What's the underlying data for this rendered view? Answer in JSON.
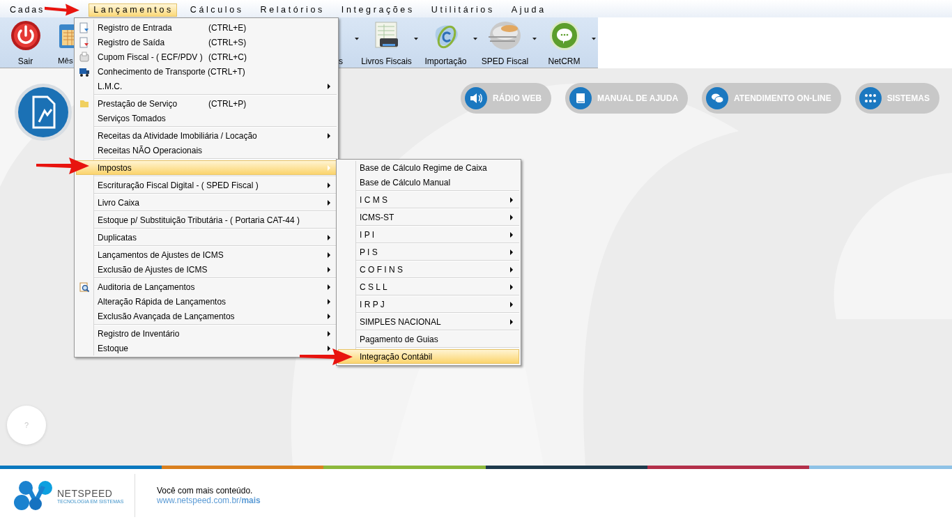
{
  "menu_bar": [
    {
      "label": "Cadas",
      "selected": false
    },
    {
      "label": "Lançamentos",
      "selected": true
    },
    {
      "label": "Cálculos",
      "selected": false
    },
    {
      "label": "Relatórios",
      "selected": false
    },
    {
      "label": "Integrações",
      "selected": false
    },
    {
      "label": "Utilitários",
      "selected": false
    },
    {
      "label": "Ajuda",
      "selected": false
    }
  ],
  "toolbar": [
    {
      "label": "Sair",
      "kind": "full",
      "dropdown": false
    },
    {
      "label": "Mês",
      "kind": "cut_right",
      "dropdown": false
    },
    {
      "label": "s",
      "kind": "cut_left",
      "dropdown": true
    },
    {
      "label": "Livros Fiscais",
      "kind": "full",
      "dropdown": true
    },
    {
      "label": "Importação",
      "kind": "full",
      "dropdown": true
    },
    {
      "label": "SPED Fiscal",
      "kind": "full",
      "dropdown": true
    },
    {
      "label": "NetCRM",
      "kind": "full",
      "dropdown": true
    }
  ],
  "quick_buttons": [
    {
      "label": "RÁDIO WEB"
    },
    {
      "label": "MANUAL DE AJUDA"
    },
    {
      "label": "ATENDIMENTO ON-LINE"
    },
    {
      "label": "SISTEMAS"
    }
  ],
  "help_button": {
    "label": "?"
  },
  "menu": {
    "groups": [
      [
        {
          "label": "Registro de Entrada",
          "shortcut": "(CTRL+E)",
          "submenu": false,
          "selected": false
        },
        {
          "label": "Registro de Saída",
          "shortcut": "(CTRL+S)",
          "submenu": false,
          "selected": false
        },
        {
          "label": "Cupom Fiscal - ( ECF/PDV )",
          "shortcut": "(CTRL+C)",
          "submenu": false,
          "selected": false
        },
        {
          "label": "Conhecimento de Transporte (CTRL+T)",
          "submenu": false,
          "selected": false
        },
        {
          "label": "L.M.C.",
          "submenu": true,
          "selected": false
        }
      ],
      [
        {
          "label": "Prestação de Serviço",
          "shortcut": "(CTRL+P)",
          "submenu": false,
          "selected": false
        },
        {
          "label": "Serviços Tomados",
          "submenu": false,
          "selected": false
        }
      ],
      [
        {
          "label": "Receitas da Atividade Imobiliária / Locação",
          "submenu": true,
          "selected": false
        },
        {
          "label": "Receitas NÃO Operacionais",
          "submenu": false,
          "selected": false
        }
      ],
      [
        {
          "label": "Impostos",
          "submenu": true,
          "selected": true
        }
      ],
      [
        {
          "label": "Escrituração Fiscal Digital - ( SPED Fiscal )",
          "submenu": true,
          "selected": false
        }
      ],
      [
        {
          "label": "Livro Caixa",
          "submenu": true,
          "selected": false
        }
      ],
      [
        {
          "label": "Estoque p/ Substituição Tributária - ( Portaria CAT-44 )",
          "submenu": false,
          "selected": false
        }
      ],
      [
        {
          "label": "Duplicatas",
          "submenu": true,
          "selected": false
        }
      ],
      [
        {
          "label": "Lançamentos de Ajustes de ICMS",
          "submenu": true,
          "selected": false
        },
        {
          "label": "Exclusão de Ajustes de ICMS",
          "submenu": true,
          "selected": false
        }
      ],
      [
        {
          "label": "Auditoria de Lançamentos",
          "submenu": true,
          "selected": false
        },
        {
          "label": "Alteração Rápida de Lançamentos",
          "submenu": true,
          "selected": false
        },
        {
          "label": "Exclusão Avançada de Lançamentos",
          "submenu": true,
          "selected": false
        }
      ],
      [
        {
          "label": "Registro de Inventário",
          "submenu": true,
          "selected": false
        },
        {
          "label": "Estoque",
          "submenu": true,
          "selected": false
        }
      ]
    ]
  },
  "submenu": {
    "groups": [
      [
        {
          "label": "Base de Cálculo Regime de Caixa",
          "submenu": false,
          "selected": false
        },
        {
          "label": "Base de Cálculo Manual",
          "submenu": false,
          "selected": false
        }
      ],
      [
        {
          "label": "I C M S",
          "submenu": true,
          "selected": false
        }
      ],
      [
        {
          "label": "ICMS-ST",
          "submenu": true,
          "selected": false
        }
      ],
      [
        {
          "label": "I P I",
          "submenu": true,
          "selected": false
        }
      ],
      [
        {
          "label": "P I S",
          "submenu": true,
          "selected": false
        }
      ],
      [
        {
          "label": "C O F I N S",
          "submenu": true,
          "selected": false
        }
      ],
      [
        {
          "label": "C S L L",
          "submenu": true,
          "selected": false
        }
      ],
      [
        {
          "label": "I R P J",
          "submenu": true,
          "selected": false
        }
      ],
      [
        {
          "label": "SIMPLES NACIONAL",
          "submenu": true,
          "selected": false
        }
      ],
      [
        {
          "label": "Pagamento de Guias",
          "submenu": false,
          "selected": false
        }
      ],
      [
        {
          "label": "Integração Contábil",
          "submenu": false,
          "selected": true
        }
      ]
    ]
  },
  "footer": {
    "brand": "NETSPEED",
    "tagline": "TECNOLOGIA EM SISTEMAS",
    "text": "Você com mais conteúdo.",
    "link": "www.netspeed.com.br/**mais**"
  }
}
